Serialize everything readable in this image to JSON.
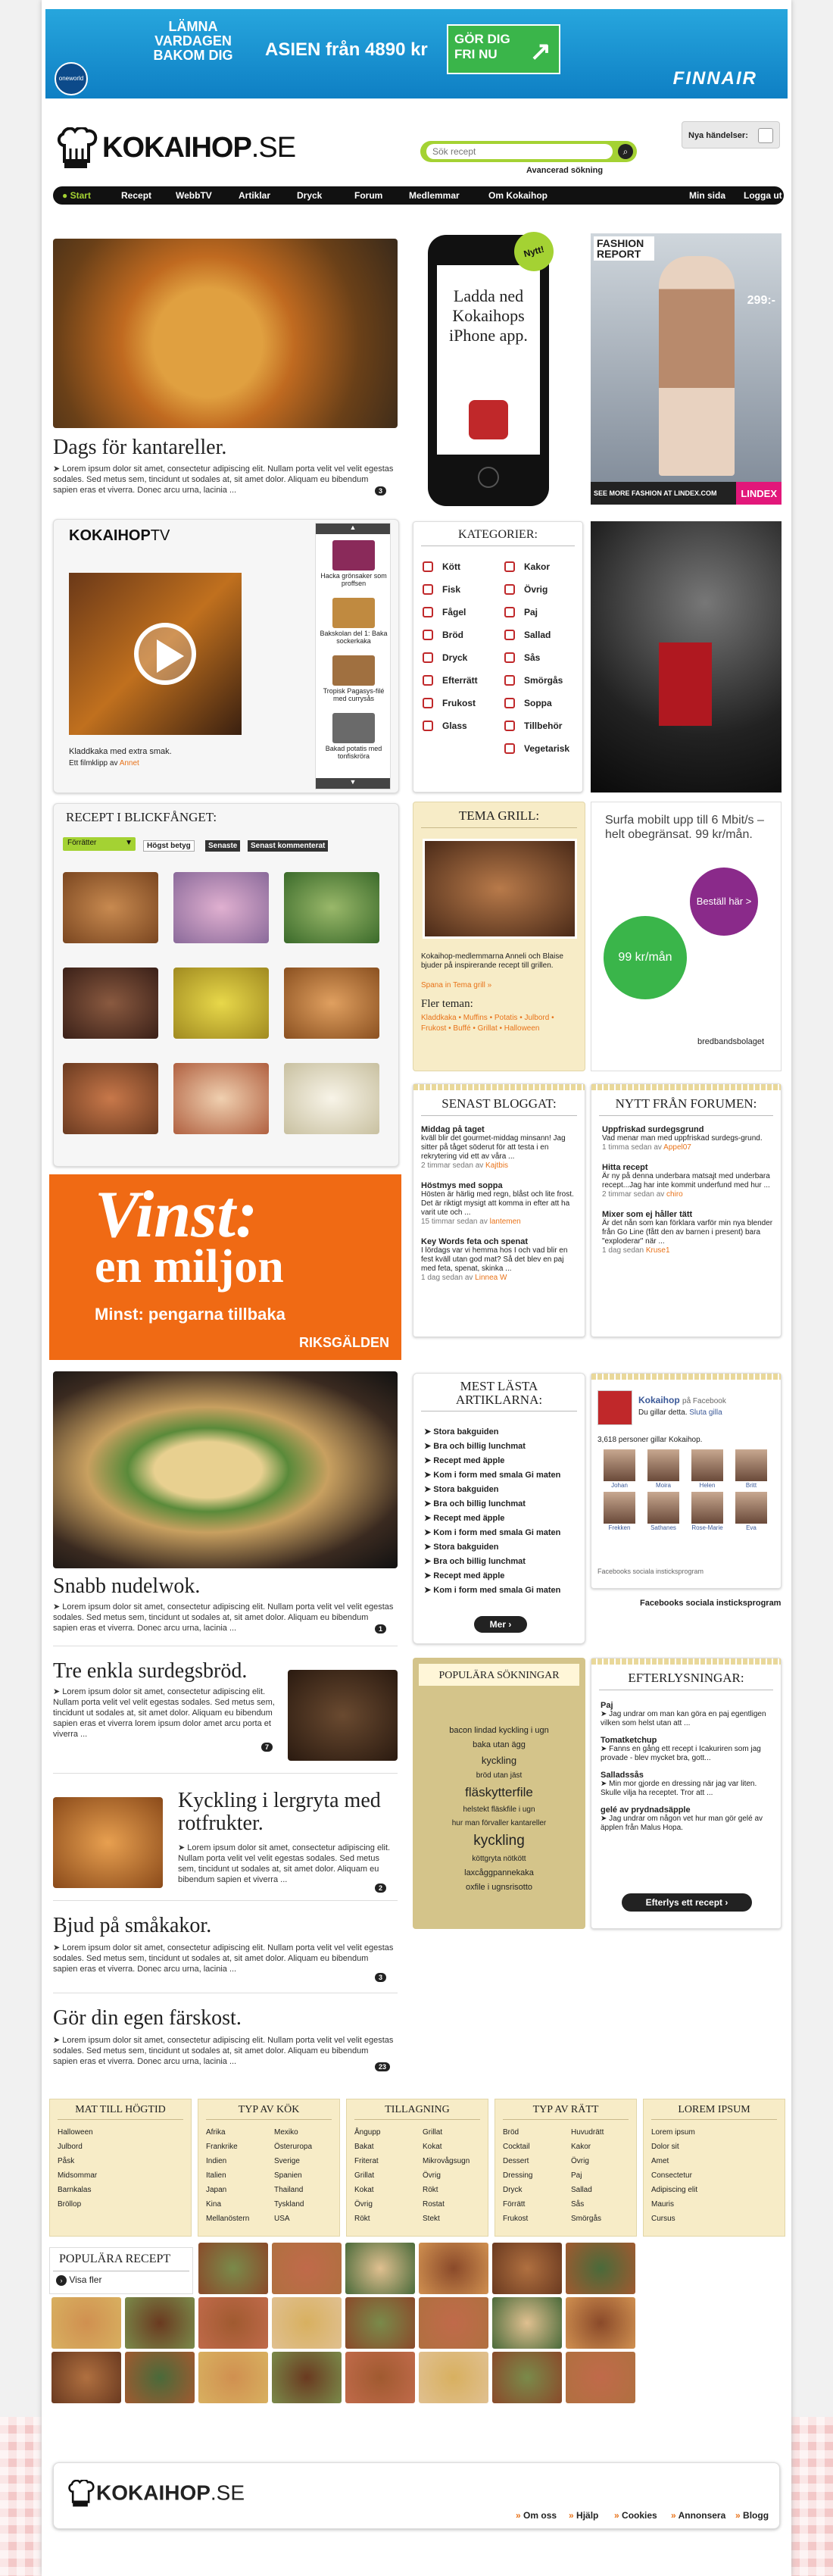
{
  "banner": {
    "lamna": "LÄMNA VARDAGEN BAKOM DIG",
    "asien": "ASIEN från 4890 kr",
    "gor": "GÖR DIG FRI NU",
    "brand": "FINNAIR",
    "badge": "oneworld"
  },
  "header": {
    "logo": "KOKAIHOP",
    "logo_se": ".SE",
    "search_placeholder": "Sök recept",
    "advanced": "Avancerad sökning",
    "nya": "Nya händelser:"
  },
  "nav": {
    "items": [
      "Start",
      "Recept",
      "WebbTV",
      "Artiklar",
      "Dryck",
      "Forum",
      "Medlemmar",
      "Om Kokaihop"
    ],
    "right": [
      "Min sida",
      "Logga ut"
    ]
  },
  "hero": {
    "title": "Dags för kantareller.",
    "text": "➤ Lorem ipsum dolor sit amet, consectetur adipiscing elit. Nullam porta velit vel velit egestas sodales. Sed metus sem, tincidunt ut sodales at, sit amet dolor. Aliquam eu bibendum sapien eras et viverra. Donec arcu urna, lacinia ...",
    "count": "3"
  },
  "iphone": {
    "nytt": "Nytt!",
    "text": "Ladda ned Kokaihops iPhone app."
  },
  "lindex": {
    "title": "FASHION REPORT",
    "price": "299:-",
    "see": "SEE MORE FASHION AT LINDEX.COM",
    "brand": "LINDEX"
  },
  "tv": {
    "title": "KOKAIHOP",
    "tv": "TV",
    "caption": "Kladdkaka med extra smak.",
    "by": "Ett filmklipp av",
    "author": "Annet",
    "side": [
      "Hacka grönsaker som proffsen",
      "Bakskolan del 1: Baka sockerkaka",
      "Tropisk Pagasys-filé med currysås",
      "Bakad potatis med tonfiskröra"
    ]
  },
  "kategorier": {
    "title": "KATEGORIER:",
    "left": [
      "Kött",
      "Fisk",
      "Fågel",
      "Bröd",
      "Dryck",
      "Efterrätt",
      "Frukost",
      "Glass"
    ],
    "right": [
      "Kakor",
      "Övrig",
      "Paj",
      "Sallad",
      "Sås",
      "Smörgås",
      "Soppa",
      "Tillbehör",
      "Vegetarisk"
    ]
  },
  "blickfang": {
    "title": "RECEPT I BLICKFÅNGET:",
    "select": "Förrätter",
    "tabs": [
      "Högst betyg",
      "Senaste",
      "Senast kommenterat"
    ]
  },
  "temagrill": {
    "title": "TEMA GRILL:",
    "text": "Kokaihop-medlemmarna Anneli och Blaise bjuder på inspirerande recept till grillen.",
    "link": "Spana in Tema grill »",
    "fler": "Fler teman:",
    "tags": "Kladdkaka • Muffins • Potatis • Julbord • Frukost • Buffé • Grillat • Halloween"
  },
  "bredband": {
    "text": "Surfa mobilt upp till 6 Mbit/s – helt obegränsat. 99 kr/mån.",
    "bubble1": "Beställ här >",
    "bubble2": "99 kr/mån",
    "brand": "bredbandsbolaget"
  },
  "bloggat": {
    "title": "SENAST BLOGGAT:",
    "posts": [
      {
        "title": "Middag på taget",
        "text": "kväll blir det gourmet-middag minsann! Jag sitter på tåget söderut för att testa i en rekrytering vid ett av våra ...",
        "meta": "2 timmar sedan av",
        "author": "Kajtbis"
      },
      {
        "title": "Höstmys med soppa",
        "text": "Hösten är härlig med regn, blåst och lite frost. Det är riktigt mysigt att komma in efter att ha varit ute och ...",
        "meta": "15 timmar sedan av",
        "author": "lantemen"
      },
      {
        "title": "Key Words feta och spenat",
        "text": "I lördags var vi hemma hos I och vad blir en fest kväll utan god mat? Så det blev en paj med feta, spenat, skinka ...",
        "meta": "1 dag sedan av",
        "author": "Linnea W"
      }
    ]
  },
  "forum": {
    "title": "NYTT FRÅN FORUMEN:",
    "posts": [
      {
        "title": "Uppfriskad surdegsgrund",
        "text": "Vad menar man med uppfriskad surdegs-grund.",
        "meta": "1 timma sedan av",
        "author": "Appel07"
      },
      {
        "title": "Hitta recept",
        "text": "Är ny på denna underbara matsajt med underbara recept...Jag har inte kommit underfund med hur ...",
        "meta": "2 timmar sedan av",
        "author": "chiro"
      },
      {
        "title": "Mixer som ej håller tätt",
        "text": "Är det nån som kan förklara varför min nya blender från Go Line (fått den av barnen i present) bara \"exploderar\" när ...",
        "meta": "1 dag sedan",
        "author": "Kruse1"
      }
    ]
  },
  "vinst": {
    "line1": "Vinst:",
    "line2": "en miljon",
    "line3": "Minst: pengarna tillbaka",
    "brand": "RIKSGÄLDEN"
  },
  "mestlasta": {
    "title": "MEST LÄSTA ARTIKLARNA:",
    "items": [
      "Stora bakguiden",
      "Bra och billig lunchmat",
      "Recept med äpple",
      "Kom i form med smala Gi maten",
      "Stora bakguiden",
      "Bra och billig lunchmat",
      "Recept med äpple",
      "Kom i form med smala Gi maten",
      "Stora bakguiden",
      "Bra och billig lunchmat",
      "Recept med äpple",
      "Kom i form med smala Gi maten"
    ],
    "button": "Mer"
  },
  "facebook": {
    "name": "Kokaihop",
    "on": "på Facebook",
    "liked": "Du gillar detta.",
    "sluta": "Sluta gilla",
    "count": "3,618 personer gillar Kokaihop.",
    "people": [
      "Johan",
      "Moira",
      "Helen",
      "Britt",
      "Frekken",
      "Sathanes",
      "Rose-Marie",
      "Eva"
    ],
    "plugin": "Facebooks sociala insticksprogram",
    "caption": "Facebooks sociala insticksprogram"
  },
  "articles": [
    {
      "title": "Snabb nudelwok.",
      "text": "➤ Lorem ipsum dolor sit amet, consectetur adipiscing elit. Nullam porta velit vel velit egestas sodales. Sed metus sem, tincidunt ut sodales at, sit amet dolor. Aliquam eu bibendum sapien eras et viverra. Donec arcu urna, lacinia ...",
      "count": "1"
    },
    {
      "title": "Tre enkla surdegsbröd.",
      "text": "➤ Lorem ipsum dolor sit amet, consectetur adipiscing elit. Nullam porta velit vel velit egestas sodales. Sed metus sem, tincidunt ut sodales at, sit amet dolor. Aliquam eu bibendum sapien eras et viverra lorem ipsum dolor amet arcu porta et viverra ...",
      "count": "7"
    },
    {
      "title": "Kyckling i lergryta med rotfrukter.",
      "text": "➤ Lorem ipsum dolor sit amet, consectetur adipiscing elit. Nullam porta velit vel velit egestas sodales. Sed metus sem, tincidunt ut sodales at, sit amet dolor. Aliquam eu bibendum sapien et viverra ...",
      "count": "2"
    },
    {
      "title": "Bjud på småkakor.",
      "text": "➤ Lorem ipsum dolor sit amet, consectetur adipiscing elit. Nullam porta velit vel velit egestas sodales. Sed metus sem, tincidunt ut sodales at, sit amet dolor. Aliquam eu bibendum sapien eras et viverra. Donec arcu urna, lacinia ...",
      "count": "3"
    },
    {
      "title": "Gör din egen färskost.",
      "text": "➤ Lorem ipsum dolor sit amet, consectetur adipiscing elit. Nullam porta velit vel velit egestas sodales. Sed metus sem, tincidunt ut sodales at, sit amet dolor. Aliquam eu bibendum sapien eras et viverra. Donec arcu urna, lacinia ...",
      "count": "23"
    }
  ],
  "populara": {
    "title": "POPULÄRA SÖKNINGAR",
    "terms": [
      "bacon lindad kyckling i ugn",
      "baka utan ägg",
      "kyckling",
      "bröd utan jäst",
      "fläskytterfile",
      "helstekt fläskfile i ugn",
      "hur man förvaller kantareller",
      "kyckling",
      "köttgryta nötkött",
      "laxcåggpannekaka",
      "oxfile i ugnsrisotto"
    ]
  },
  "efterlysningar": {
    "title": "EFTERLYSNINGAR:",
    "items": [
      {
        "title": "Paj",
        "text": "➤ Jag undrar om man kan göra en paj egentligen vilken som helst utan att ..."
      },
      {
        "title": "Tomatketchup",
        "text": "➤ Fanns en gång ett recept i Icakuriren som jag provade - blev mycket bra, gott..."
      },
      {
        "title": "Salladssås",
        "text": "➤ Min mor gjorde en dressing när jag var liten. Skulle vilja ha receptet. Tror att ..."
      },
      {
        "title": "gelé av prydnadsäpple",
        "text": "➤ Jag undrar om någon vet hur man gör gelé av äpplen från Malus Hopa."
      }
    ],
    "button": "Efterlys ett recept"
  },
  "bottomcats": [
    {
      "title": "MAT TILL HÖGTID",
      "col1": [
        "Halloween",
        "Julbord",
        "Påsk",
        "Midsommar",
        "Barnkalas",
        "Bröllop"
      ],
      "col2": []
    },
    {
      "title": "TYP AV KÖK",
      "col1": [
        "Afrika",
        "Frankrike",
        "Indien",
        "Italien",
        "Japan",
        "Kina",
        "Mellanöstern"
      ],
      "col2": [
        "Mexiko",
        "Österuropa",
        "Sverige",
        "Spanien",
        "Thailand",
        "Tyskland",
        "USA"
      ]
    },
    {
      "title": "TILLAGNING",
      "col1": [
        "Ångupp",
        "Bakat",
        "Friterat",
        "Grillat",
        "Kokat",
        "Övrig",
        "Rökt"
      ],
      "col2": [
        "Grillat",
        "Kokat",
        "Mikrovågsugn",
        "Övrig",
        "Rökt",
        "Rostat",
        "Stekt"
      ]
    },
    {
      "title": "TYP AV RÄTT",
      "col1": [
        "Bröd",
        "Cocktail",
        "Dessert",
        "Dressing",
        "Dryck",
        "Förrätt",
        "Frukost"
      ],
      "col2": [
        "Huvudrätt",
        "Kakor",
        "Övrig",
        "Paj",
        "Sallad",
        "Sås",
        "Smörgås"
      ]
    },
    {
      "title": "LOREM IPSUM",
      "col1": [
        "Lorem ipsum",
        "Dolor sit",
        "Amet",
        "Consectetur",
        "Adipiscing elit",
        "Mauris",
        "Cursus"
      ],
      "col2": []
    }
  ],
  "popularecept": {
    "title": "POPULÄRA RECEPT",
    "visa": "Visa fler"
  },
  "footer": {
    "logo": "KOKAIHOP",
    "logo_se": ".SE",
    "links": [
      "Om oss",
      "Hjälp",
      "Cookies",
      "Annonsera",
      "Blogg"
    ]
  },
  "colors": {
    "accent": "#e8731a",
    "green": "#a4d233",
    "nav": "#111111",
    "tan": "#f7ecc7"
  }
}
